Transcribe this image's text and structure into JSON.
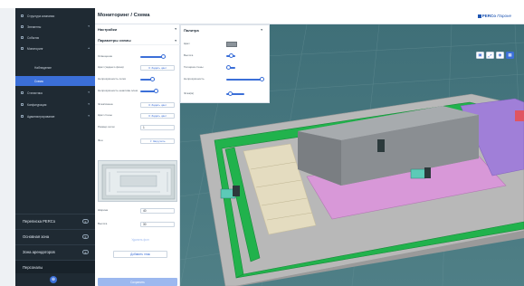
{
  "sidebar": {
    "items": [
      {
        "label": "Структура компании",
        "chevron": ""
      },
      {
        "label": "Элементы",
        "chevron": "▾"
      },
      {
        "label": "События",
        "chevron": ""
      },
      {
        "label": "Мониторинг",
        "chevron": "▴"
      },
      {
        "label": "Наблюдение",
        "chevron": ""
      },
      {
        "label": "Схема",
        "chevron": ""
      },
      {
        "label": "Статистика",
        "chevron": "▾"
      },
      {
        "label": "Конфигурация",
        "chevron": "▾"
      },
      {
        "label": "Администрирование",
        "chevron": "▾"
      }
    ],
    "bottom": [
      {
        "label": "Переписка PERCo",
        "pill": "0"
      },
      {
        "label": "Основная зона",
        "pill": "0"
      },
      {
        "label": "Зона арендаторов",
        "pill": "0"
      },
      {
        "label": "Персоналы",
        "pill": ""
      }
    ],
    "globe_icon": "globe-icon"
  },
  "header": {
    "title": "Мониторинг / Схема",
    "brand": "PERCo",
    "brand_sub": "Пароне"
  },
  "settings": {
    "section": "Настройки",
    "subsection": "Параметры схемы",
    "rows": {
      "lighting": "Освещение",
      "bg_color": "Цвет (заднего фона)",
      "transparency_grid": "Непрозрачность сетки",
      "transparency_elements": "Непрозрачность неактивн.элем.",
      "floor": "Этаж/смена",
      "wall_color": "Цвет стены",
      "grid_size": "Размер сетки",
      "background": "Фон"
    },
    "pick_color": "Задать цвет",
    "grid_size_value": "1",
    "upload": "Загрузить",
    "width_label": "Ширина",
    "width_value": "40",
    "height_label": "Высота",
    "height_value": "30",
    "reset_label": "Удалить фон",
    "add_floor": "Добавить этаж",
    "save": "Сохранить"
  },
  "palette": {
    "title": "Палитра",
    "color_label": "Цвет",
    "height_label": "Высота",
    "wall_label": "Толщина стены",
    "transp_label": "Непрозрачность",
    "floor_label": "Этаж(м)",
    "swatch_color": "#8c949b"
  },
  "scene": {
    "controls": [
      "layers-icon",
      "expand-icon",
      "camera-icon",
      "grid-icon"
    ]
  },
  "colors": {
    "accent": "#3b6fd8",
    "sidebar_bg": "#1f2a33",
    "scene_bg": "#45747d",
    "green": "#1fb34a",
    "pink": "#d896d7",
    "purple": "#9e7fd8",
    "building": "#8f9396",
    "floor": "#b9b9b9"
  }
}
